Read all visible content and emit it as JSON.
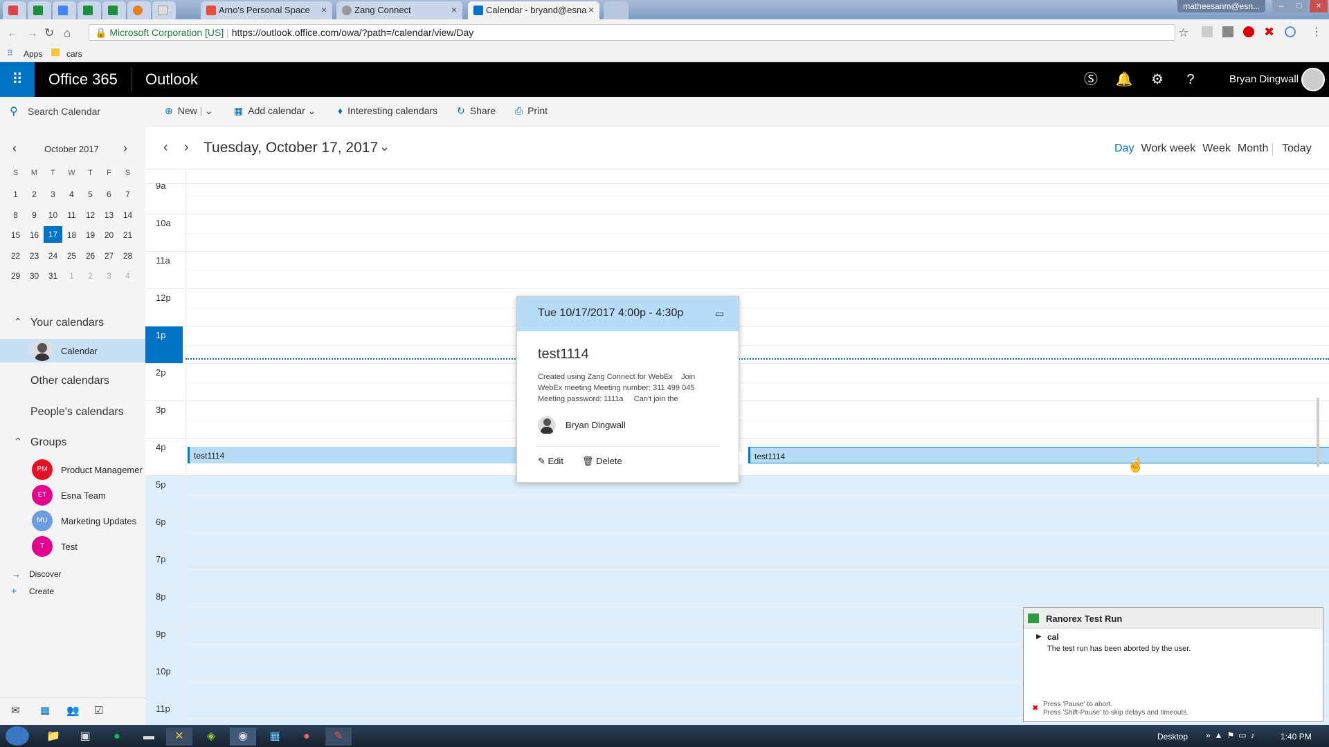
{
  "browser": {
    "tabs": [
      {
        "label": "Arno's Personal Space",
        "color": "#e74c3c"
      },
      {
        "label": "Zang Connect",
        "color": "#999999"
      },
      {
        "label": "Calendar - bryand@esna",
        "color": "#0072c6"
      }
    ],
    "window_user": "matheesanm@esn...",
    "security_label": "Microsoft Corporation [US]",
    "url": "https://outlook.office.com/owa/?path=/calendar/view/Day",
    "bookmarks": {
      "apps": "Apps",
      "folder": "cars"
    }
  },
  "suite": {
    "brand": "Office 365",
    "app": "Outlook",
    "user": "Bryan Dingwall",
    "accent": "#0072c6"
  },
  "commands": {
    "search_placeholder": "Search Calendar",
    "new": "New",
    "add_calendar": "Add calendar",
    "interesting": "Interesting calendars",
    "share": "Share",
    "print": "Print"
  },
  "view": {
    "date_title": "Tuesday, October 17, 2017",
    "modes": [
      "Day",
      "Work week",
      "Week",
      "Month"
    ],
    "active_mode": "Day",
    "today": "Today"
  },
  "mini_calendar": {
    "month": "October 2017",
    "weekdays": [
      "S",
      "M",
      "T",
      "W",
      "T",
      "F",
      "S"
    ],
    "weeks": [
      [
        "1",
        "2",
        "3",
        "4",
        "5",
        "6",
        "7"
      ],
      [
        "8",
        "9",
        "10",
        "11",
        "12",
        "13",
        "14"
      ],
      [
        "15",
        "16",
        "17",
        "18",
        "19",
        "20",
        "21"
      ],
      [
        "22",
        "23",
        "24",
        "25",
        "26",
        "27",
        "28"
      ],
      [
        "29",
        "30",
        "31",
        "1",
        "2",
        "3",
        "4"
      ]
    ],
    "today": "17"
  },
  "sidebar": {
    "your_calendars": "Your calendars",
    "calendar": "Calendar",
    "other_calendars": "Other calendars",
    "peoples_calendars": "People's calendars",
    "groups": "Groups",
    "group_items": [
      {
        "initials": "PM",
        "name": "Product Managemer",
        "color": "#e81123"
      },
      {
        "initials": "ET",
        "name": "Esna Team",
        "color": "#e3008c"
      },
      {
        "initials": "MU",
        "name": "Marketing Updates",
        "color": "#6b9be0"
      },
      {
        "initials": "T",
        "name": "Test",
        "color": "#e3008c"
      }
    ],
    "discover": "Discover",
    "create": "Create"
  },
  "hours": [
    "9a",
    "10a",
    "11a",
    "12p",
    "1p",
    "2p",
    "3p",
    "4p",
    "5p",
    "6p",
    "7p",
    "8p",
    "9p",
    "10p",
    "11p"
  ],
  "current_hour": "1p",
  "events": [
    {
      "title": "test1114"
    },
    {
      "title": "test1114"
    }
  ],
  "popup": {
    "time": "Tue 10/17/2017 4:00p - 4:30p",
    "title": "test1114",
    "desc1": "Created using Zang Connect for WebEx    Join",
    "desc2": "WebEx meeting Meeting number: 311 499 045",
    "desc3": "Meeting password: 1111a     Can't join the",
    "organizer": "Bryan Dingwall",
    "edit": "Edit",
    "delete": "Delete"
  },
  "ranorex": {
    "title": "Ranorex Test Run",
    "item": "cal",
    "message": "The test run has been aborted by the user.",
    "hint1": "Press 'Pause' to abort.",
    "hint2": "Press 'Shift-Pause' to skip delays and timeouts."
  },
  "taskbar": {
    "desktop": "Desktop",
    "clock": "1:40 PM"
  }
}
